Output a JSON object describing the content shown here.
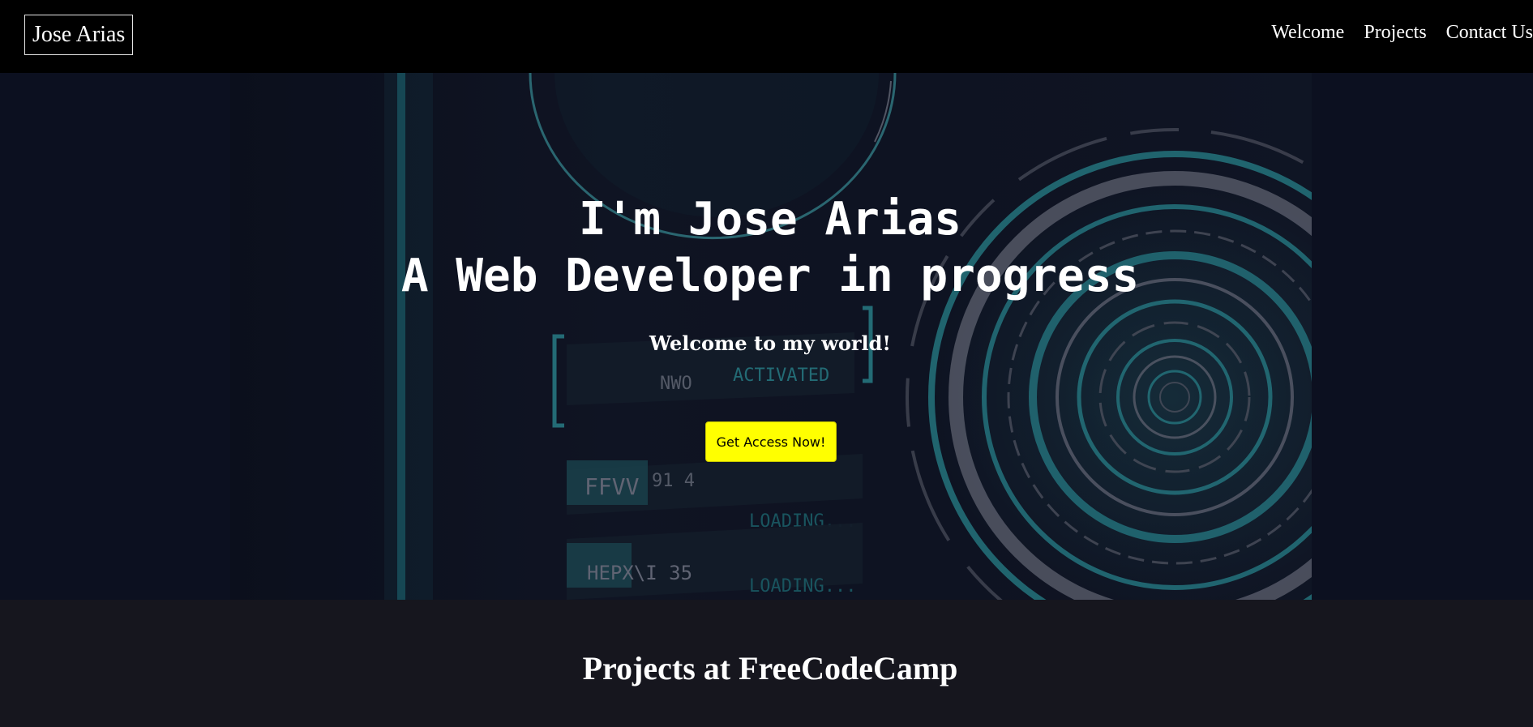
{
  "navbar": {
    "logo": "Jose Arias",
    "links": [
      "Welcome",
      "Projects",
      "Contact Us"
    ]
  },
  "hero": {
    "title_line1": "I'm Jose Arias",
    "title_line2": "A Web Developer in progress",
    "subtitle": "Welcome to my world!",
    "cta_label": "Get Access Now!",
    "background_decoration_text": [
      "NWO",
      "ACTIVATED",
      "FFVV",
      "91 4",
      "LOADING...",
      "HEPX\\I 35",
      "LOADING..."
    ]
  },
  "projects": {
    "title": "Projects at FreeCodeCamp"
  },
  "colors": {
    "navbar_bg": "#000000",
    "hero_bg": "#0c1020",
    "accent_teal": "#2a8d96",
    "cta_bg": "#ffff00",
    "section_bg": "#16161e"
  }
}
